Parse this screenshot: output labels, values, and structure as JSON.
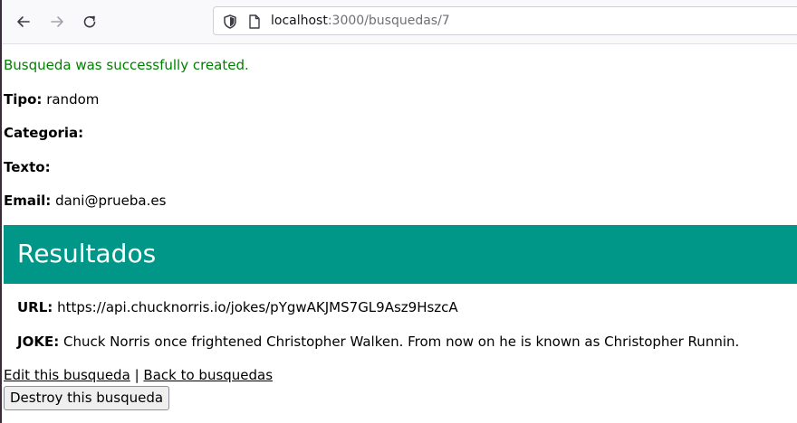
{
  "browser": {
    "url_host": "localhost",
    "url_path": ":3000/busquedas/7",
    "icons": {
      "back": "arrow-left-icon",
      "forward": "arrow-right-icon",
      "reload": "reload-icon",
      "security": "shield-icon",
      "page": "page-icon"
    }
  },
  "page": {
    "notice": "Busqueda was successfully created.",
    "fields": {
      "tipo_label": "Tipo:",
      "tipo_value": "random",
      "categoria_label": "Categoria:",
      "categoria_value": "",
      "texto_label": "Texto:",
      "texto_value": "",
      "email_label": "Email:",
      "email_value": "dani@prueba.es"
    },
    "results": {
      "title": "Resultados",
      "url_label": "URL:",
      "url_value": "https://api.chucknorris.io/jokes/pYgwAKJMS7GL9Asz9HszcA",
      "joke_label": "JOKE:",
      "joke_value": "Chuck Norris once frightened Christopher Walken. From now on he is known as Christopher Runnin."
    },
    "links": {
      "edit": "Edit this busqueda",
      "separator": "|",
      "back": "Back to busquedas"
    },
    "destroy_button": "Destroy this busqueda"
  },
  "colors": {
    "notice": "#008000",
    "results_header": "#009688"
  }
}
